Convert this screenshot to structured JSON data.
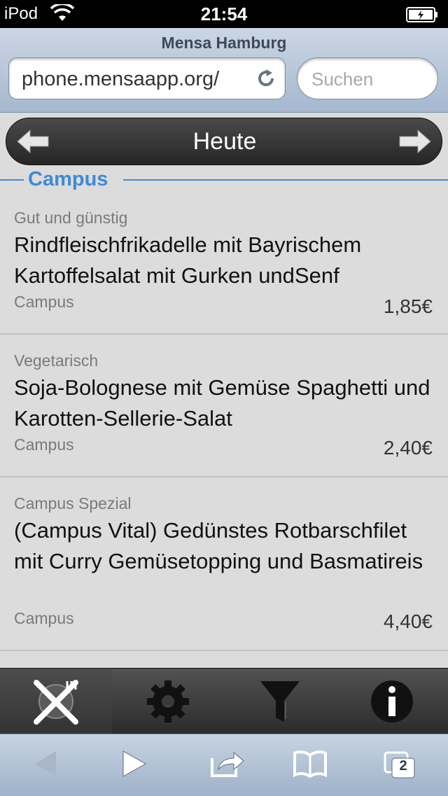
{
  "status_bar": {
    "carrier": "iPod",
    "time": "21:54"
  },
  "browser": {
    "page_title": "Mensa Hamburg",
    "url": "phone.mensaapp.org/",
    "search_placeholder": "Suchen",
    "tab_count": "2"
  },
  "app": {
    "nav_title": "Heute",
    "section_title": "Campus",
    "items": [
      {
        "category": "Gut und günstig",
        "dish": "Rindfleischfrikadelle mit Bayrischem Kartoffelsalat mit Gurken undSenf",
        "location": "Campus",
        "price": "1,85€"
      },
      {
        "category": "Vegetarisch",
        "dish": "Soja-Bolognese mit Gemüse Spaghetti und Karotten-Sellerie-Salat",
        "location": "Campus",
        "price": "2,40€"
      },
      {
        "category": "Campus Spezial",
        "dish": "(Campus Vital) Gedünstes Rotbarschfilet mit Curry Gemüsetopping und Basmatireis",
        "location": "Campus",
        "price": "4,40€"
      }
    ],
    "tabs": [
      {
        "icon": "fork-knife-icon"
      },
      {
        "icon": "gear-icon"
      },
      {
        "icon": "filter-icon"
      },
      {
        "icon": "info-icon"
      }
    ]
  },
  "colors": {
    "accent": "#3d8bd6",
    "nav_bg": "#333333",
    "list_bg": "#dcdcdc"
  }
}
